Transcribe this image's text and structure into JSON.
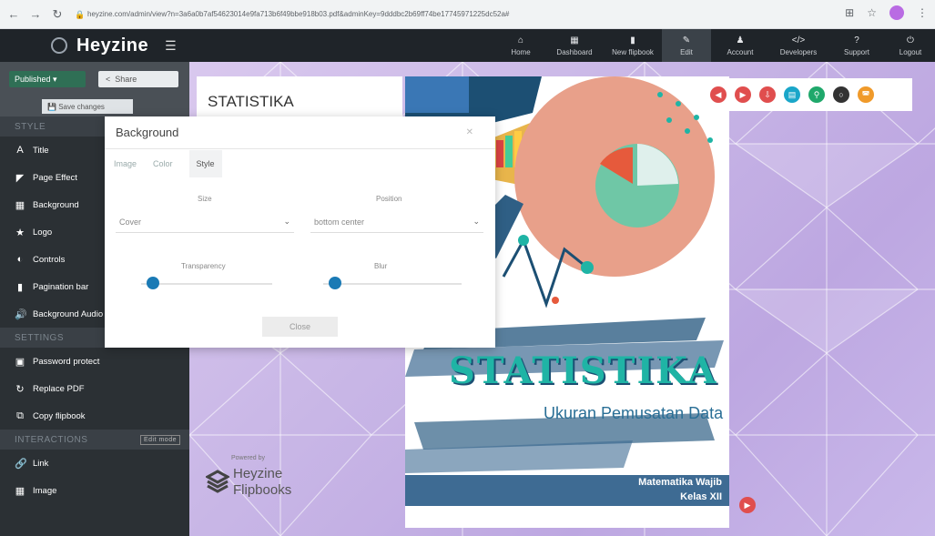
{
  "browser": {
    "url": "heyzine.com/admin/view?n=3a6a0b7af54623014e9fa713b6f49bbe918b03.pdf&adminKey=9dddbc2b69ff74be17745971225dc52a#"
  },
  "app": {
    "brand": "Heyzine",
    "nav": [
      {
        "label": "Home",
        "icon": "home-icon"
      },
      {
        "label": "Dashboard",
        "icon": "dashboard-icon"
      },
      {
        "label": "New flipbook",
        "icon": "new-flipbook-icon"
      },
      {
        "label": "Edit",
        "icon": "edit-icon"
      },
      {
        "label": "Account",
        "icon": "account-icon"
      },
      {
        "label": "Developers",
        "icon": "developers-icon"
      },
      {
        "label": "Support",
        "icon": "support-icon"
      },
      {
        "label": "Logout",
        "icon": "logout-icon"
      }
    ]
  },
  "sidebar": {
    "published": "Published",
    "share": "Share",
    "save": "Save changes",
    "style_header": "STYLE",
    "style_items": [
      "Title",
      "Page Effect",
      "Background",
      "Logo",
      "Controls",
      "Pagination bar",
      "Background Audio"
    ],
    "settings_header": "SETTINGS",
    "settings_items": [
      "Password protect",
      "Replace PDF",
      "Copy flipbook"
    ],
    "interactions_header": "INTERACTIONS",
    "edit_mode": "Edit mode",
    "interaction_items": [
      "Link",
      "Image"
    ]
  },
  "page": {
    "title": "STATISTIKA",
    "powered_by": "Powered by",
    "brand_line1": "Heyzine",
    "brand_line2": "Flipbooks"
  },
  "cover": {
    "title": "STATISTIKA",
    "subtitle": "Ukuran Pemusatan Data",
    "line1": "Matematika Wajib",
    "line2": "Kelas XII"
  },
  "dialog": {
    "title": "Background",
    "tabs": [
      "Image",
      "Color",
      "Style"
    ],
    "active_tab": "Style",
    "size_label": "Size",
    "size_value": "Cover",
    "position_label": "Position",
    "position_value": "bottom center",
    "transparency_label": "Transparency",
    "transparency_level": 0.0,
    "blur_label": "Blur",
    "blur_level": 0.0,
    "close": "Close"
  },
  "colors": {
    "accent": "#1a7ab5",
    "toolbar_buttons": [
      "#e04e4e",
      "#e04e4e",
      "#e04e4e",
      "#1aa6c9",
      "#1fa86b",
      "#333333",
      "#f09a2a"
    ]
  }
}
